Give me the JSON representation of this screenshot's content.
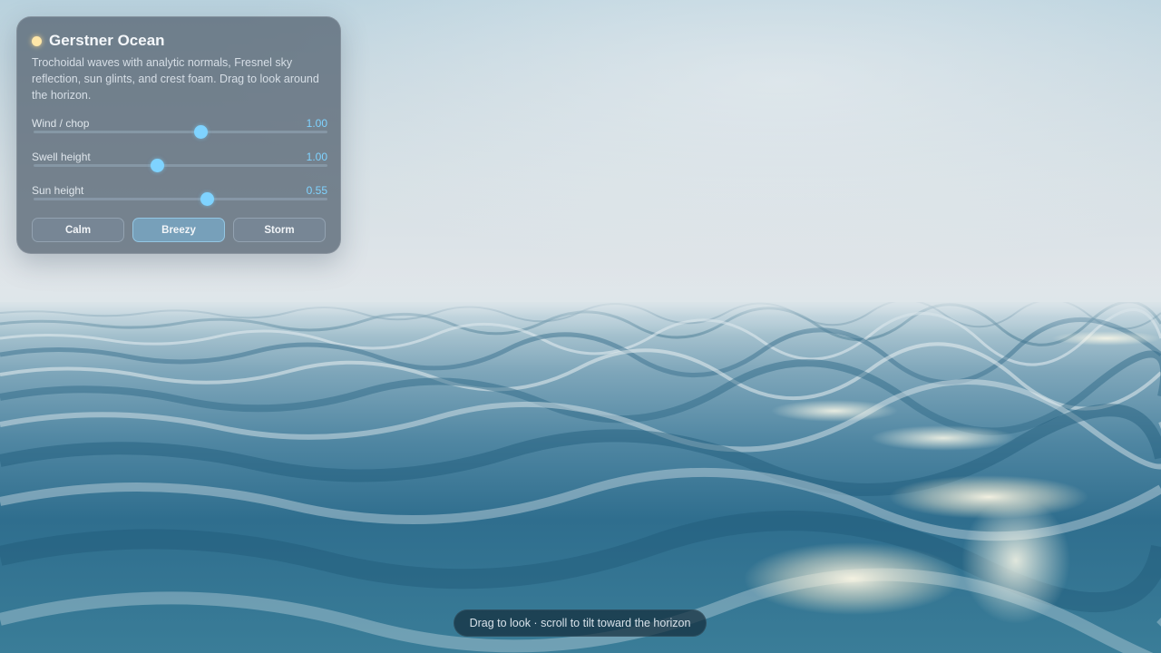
{
  "panel": {
    "title": "Gerstner Ocean",
    "description": "Trochoidal waves with analytic normals, Fresnel sky reflection, sun glints, and crest foam. Drag to look around the horizon.",
    "sliders": [
      {
        "label": "Wind / chop",
        "value_text": "1.00",
        "level": 0.57
      },
      {
        "label": "Swell height",
        "value_text": "1.00",
        "level": 0.42
      },
      {
        "label": "Sun height",
        "value_text": "0.55",
        "level": 0.59
      }
    ],
    "presets": [
      {
        "label": "Calm",
        "active": false
      },
      {
        "label": "Breezy",
        "active": true
      },
      {
        "label": "Storm",
        "active": false
      }
    ]
  },
  "hint": "Drag to look · scroll to tilt toward the horizon",
  "colors": {
    "accent": "#7fd3ff",
    "sun": "#ffe7a8",
    "water_deep": "#2f6e8e",
    "sky": "#d6e0e5"
  },
  "icons": {
    "status": "sun-indicator-icon"
  }
}
